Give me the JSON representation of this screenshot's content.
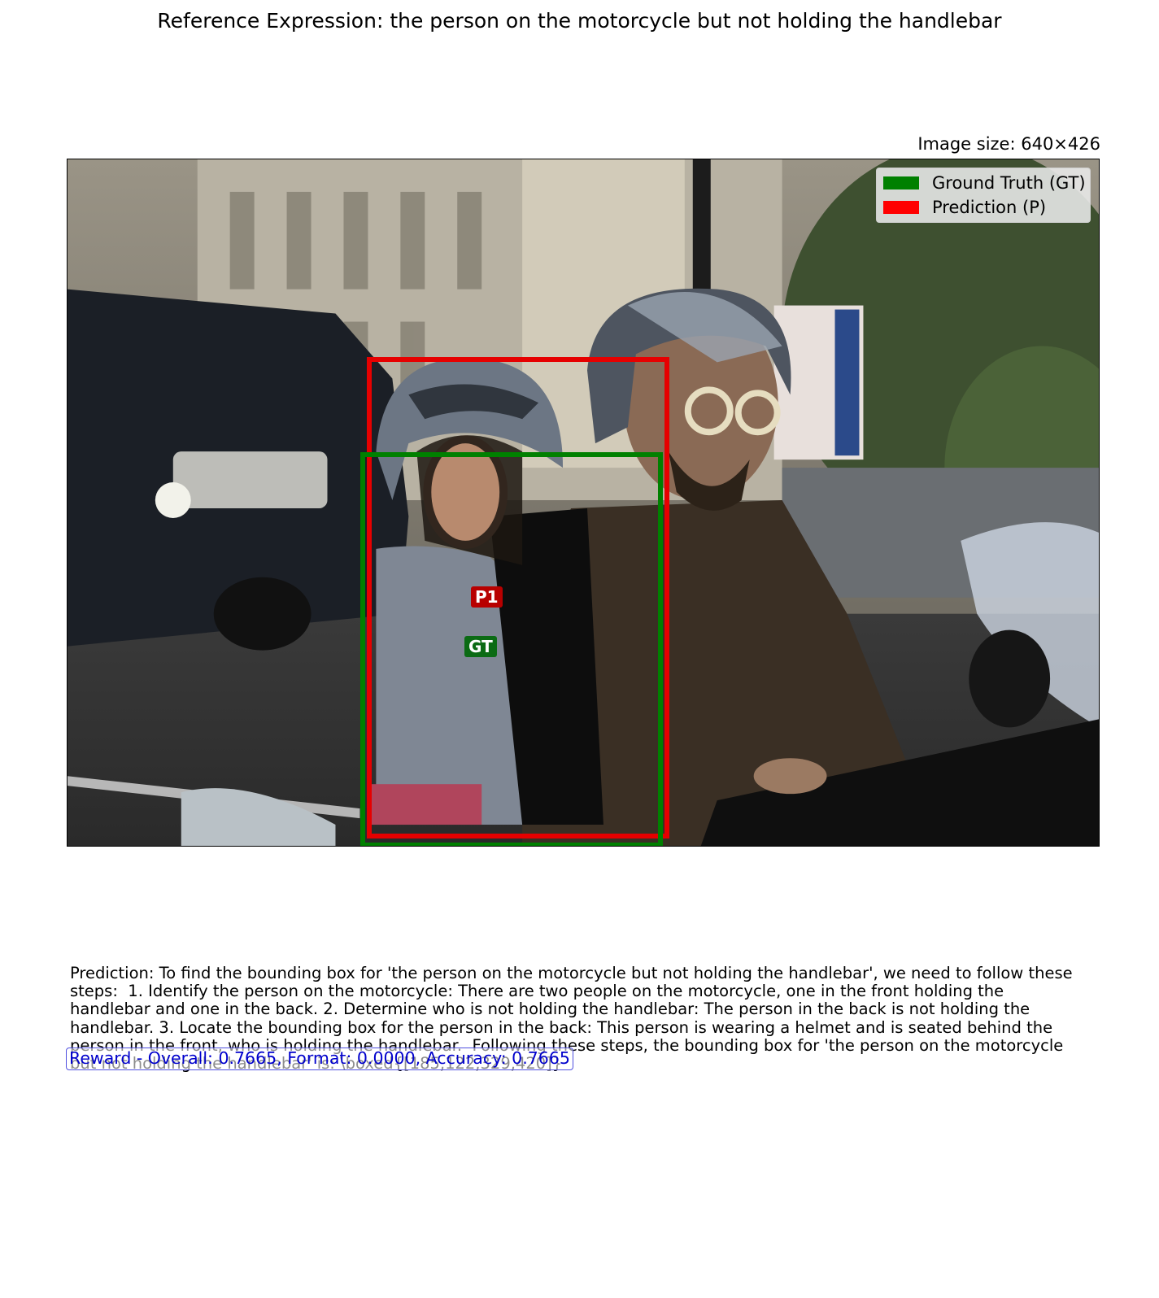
{
  "header": {
    "title": "Reference Expression: the person on the motorcycle but not holding the handlebar",
    "image_size": "Image size: 640×426"
  },
  "legend": {
    "ground_truth": {
      "label": "Ground Truth (GT)",
      "color": "#008000"
    },
    "prediction": {
      "label": "Prediction (P)",
      "color": "#ff0000"
    }
  },
  "boxes": {
    "prediction_tag": "P1",
    "ground_truth_tag": "GT"
  },
  "prediction_text": "Prediction: To find the bounding box for 'the person on the motorcycle but not holding the handlebar', we need to follow these steps:  1. Identify the person on the motorcycle: There are two people on the motorcycle, one in the front holding the handlebar and one in the back. 2. Determine who is not holding the handlebar: The person in the back is not holding the handlebar. 3. Locate the bounding box for the person in the back: This person is wearing a helmet and is seated behind the person in the front, who is holding the handlebar.  Following these steps, the bounding box for 'the person on the motorcycle but not holding the handlebar' is: \\boxed{[185,122,329,420]}",
  "reward": "Reward - Overall: 0.7665, Format: 0.0000, Accuracy: 0.7665"
}
